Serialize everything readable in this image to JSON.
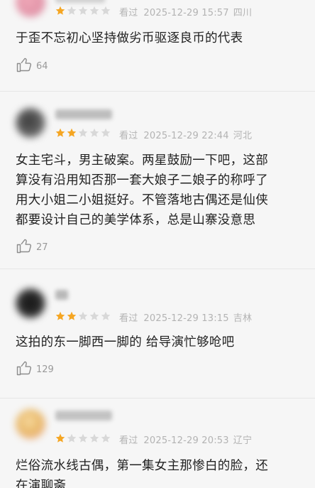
{
  "reviews": [
    {
      "rating": 1,
      "seen_label": "看过",
      "date": "2025-12-29 15:57",
      "location": "四川",
      "comment": "于歪不忘初心坚持做劣币驱逐良币的代表",
      "likes": "64"
    },
    {
      "rating": 2,
      "seen_label": "看过",
      "date": "2025-12-29 22:44",
      "location": "河北",
      "comment": "女主宅斗，男主破案。两星鼓励一下吧，这部\n算没有沿用知否那一套大娘子二娘子的称呼了\n用大小姐二小姐挺好。不管落地古偶还是仙侠\n都要设计自己的美学体系，总是山寨没意思",
      "likes": "27"
    },
    {
      "rating": 2,
      "seen_label": "看过",
      "date": "2025-12-29 13:15",
      "location": "吉林",
      "comment": "这拍的东一脚西一脚的 给导演忙够呛吧",
      "likes": "129"
    },
    {
      "rating": 1,
      "seen_label": "看过",
      "date": "2025-12-29 20:53",
      "location": "辽宁",
      "comment": "烂俗流水线古偶，第一集女主那惨白的脸，还\n在演聊斋",
      "likes": ""
    }
  ],
  "colors": {
    "star_filled": "#f5a623",
    "star_empty": "#d8d8d8",
    "text": "#222222",
    "meta": "#b3b3b3",
    "background": "#f6f6f6"
  },
  "icons": {
    "like": "thumbs-up-icon",
    "star": "star-icon"
  }
}
